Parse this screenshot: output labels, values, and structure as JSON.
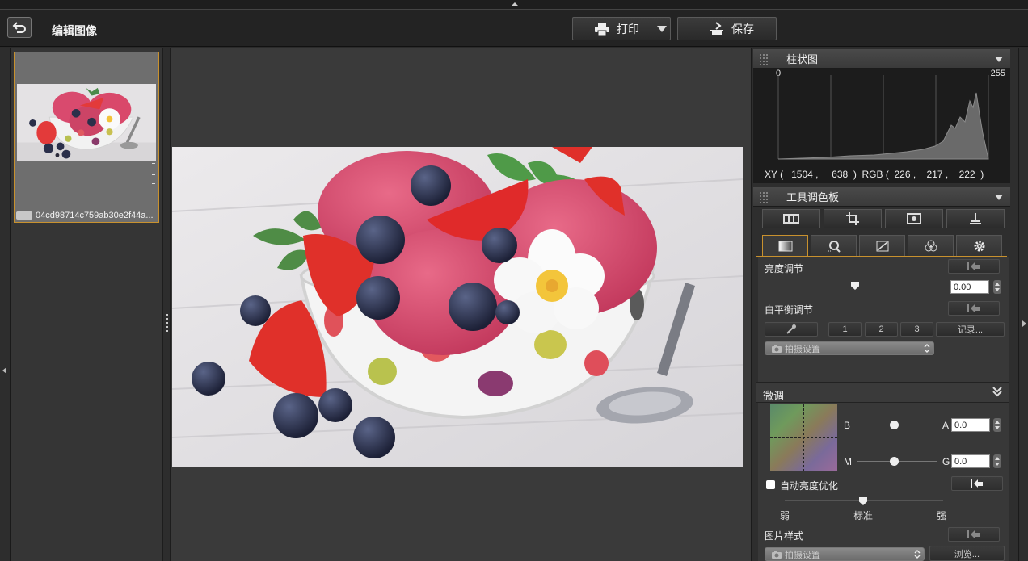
{
  "header": {
    "title": "编辑图像",
    "print_label": "打印",
    "save_label": "保存"
  },
  "thumbnail": {
    "filename": "04cd98714c759ab30e2f44a..."
  },
  "histogram": {
    "title": "柱状图",
    "min_label": "0",
    "max_label": "255",
    "readout": "XY (   1504 ,     638  )  RGB (  226 ,    217 ,    222  )"
  },
  "tool_palette": {
    "title": "工具调色板",
    "brightness_label": "亮度调节",
    "brightness_value": "0.00",
    "brightness_level": 0.5,
    "white_balance_label": "白平衡调节",
    "wb_buttons": [
      "1",
      "2",
      "3"
    ],
    "wb_record": "记录...",
    "wb_select": "拍摄设置"
  },
  "fine_tune": {
    "title": "微调",
    "b_label": "B",
    "a_label": "A",
    "a_value": "0.0",
    "m_label": "M",
    "g_label": "G",
    "g_value": "0.0",
    "auto_label": "自动亮度优化",
    "level_weak": "弱",
    "level_std": "标准",
    "level_strong": "强",
    "style_label": "图片样式",
    "style_select": "拍摄设置",
    "browse_label": "浏览..."
  },
  "colors": {
    "accent": "#c8912e",
    "panel": "#2e2e2e",
    "header": "#232323"
  }
}
